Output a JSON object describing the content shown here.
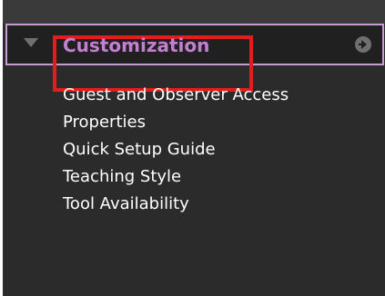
{
  "header": {
    "title": "Customization"
  },
  "menu": {
    "items": [
      "Guest and Observer Access",
      "Properties",
      "Quick Setup Guide",
      "Teaching Style",
      "Tool Availability"
    ]
  },
  "colors": {
    "background": "#2b2b2b",
    "headerBorder": "#c79cd2",
    "highlightBox": "#e11d1d",
    "title": "#c47fd0",
    "text": "#ffffff",
    "icon": "#6f6f6f"
  },
  "icons": {
    "collapse": "caret-down-icon",
    "goRight": "arrow-right-circle-icon"
  }
}
